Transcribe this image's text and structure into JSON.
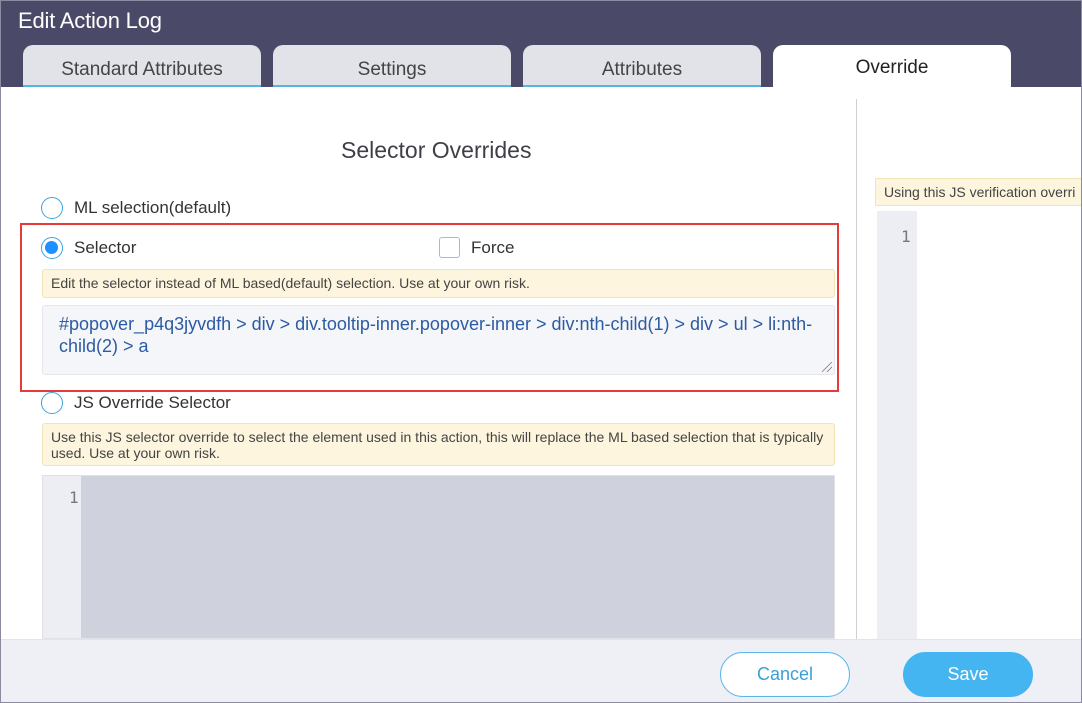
{
  "dialog": {
    "title": "Edit Action Log"
  },
  "tabs": [
    {
      "label": "Standard Attributes",
      "active": false
    },
    {
      "label": "Settings",
      "active": false
    },
    {
      "label": "Attributes",
      "active": false
    },
    {
      "label": "Override",
      "active": true
    }
  ],
  "section": {
    "title": "Selector Overrides"
  },
  "options": {
    "ml_selection": {
      "label": "ML selection(default)",
      "checked": false
    },
    "selector": {
      "label": "Selector",
      "checked": true
    },
    "force": {
      "label": "Force",
      "checked": false
    },
    "js_override": {
      "label": "JS Override Selector",
      "checked": false
    }
  },
  "notes": {
    "selector_note": "Edit the selector instead of ML based(default) selection. Use at your own risk.",
    "js_note": "Use this JS selector override to select the element used in this action, this will replace the ML based selection that is typically used. Use at your own risk.",
    "verification_note": "Using this JS verification overri"
  },
  "selector_input": {
    "value": "#popover_p4q3jyvdfh > div > div.tooltip-inner.popover-inner > div:nth-child(1) > div > ul > li:nth-child(2) > a"
  },
  "code_editor": {
    "line_number": "1"
  },
  "right_editor": {
    "line_number": "1"
  },
  "footer": {
    "cancel_label": "Cancel",
    "save_label": "Save"
  },
  "colors": {
    "header_bg": "#4a4a68",
    "accent": "#44b5f0",
    "highlight_border": "#e43b3b",
    "note_bg": "#fdf5dd"
  }
}
